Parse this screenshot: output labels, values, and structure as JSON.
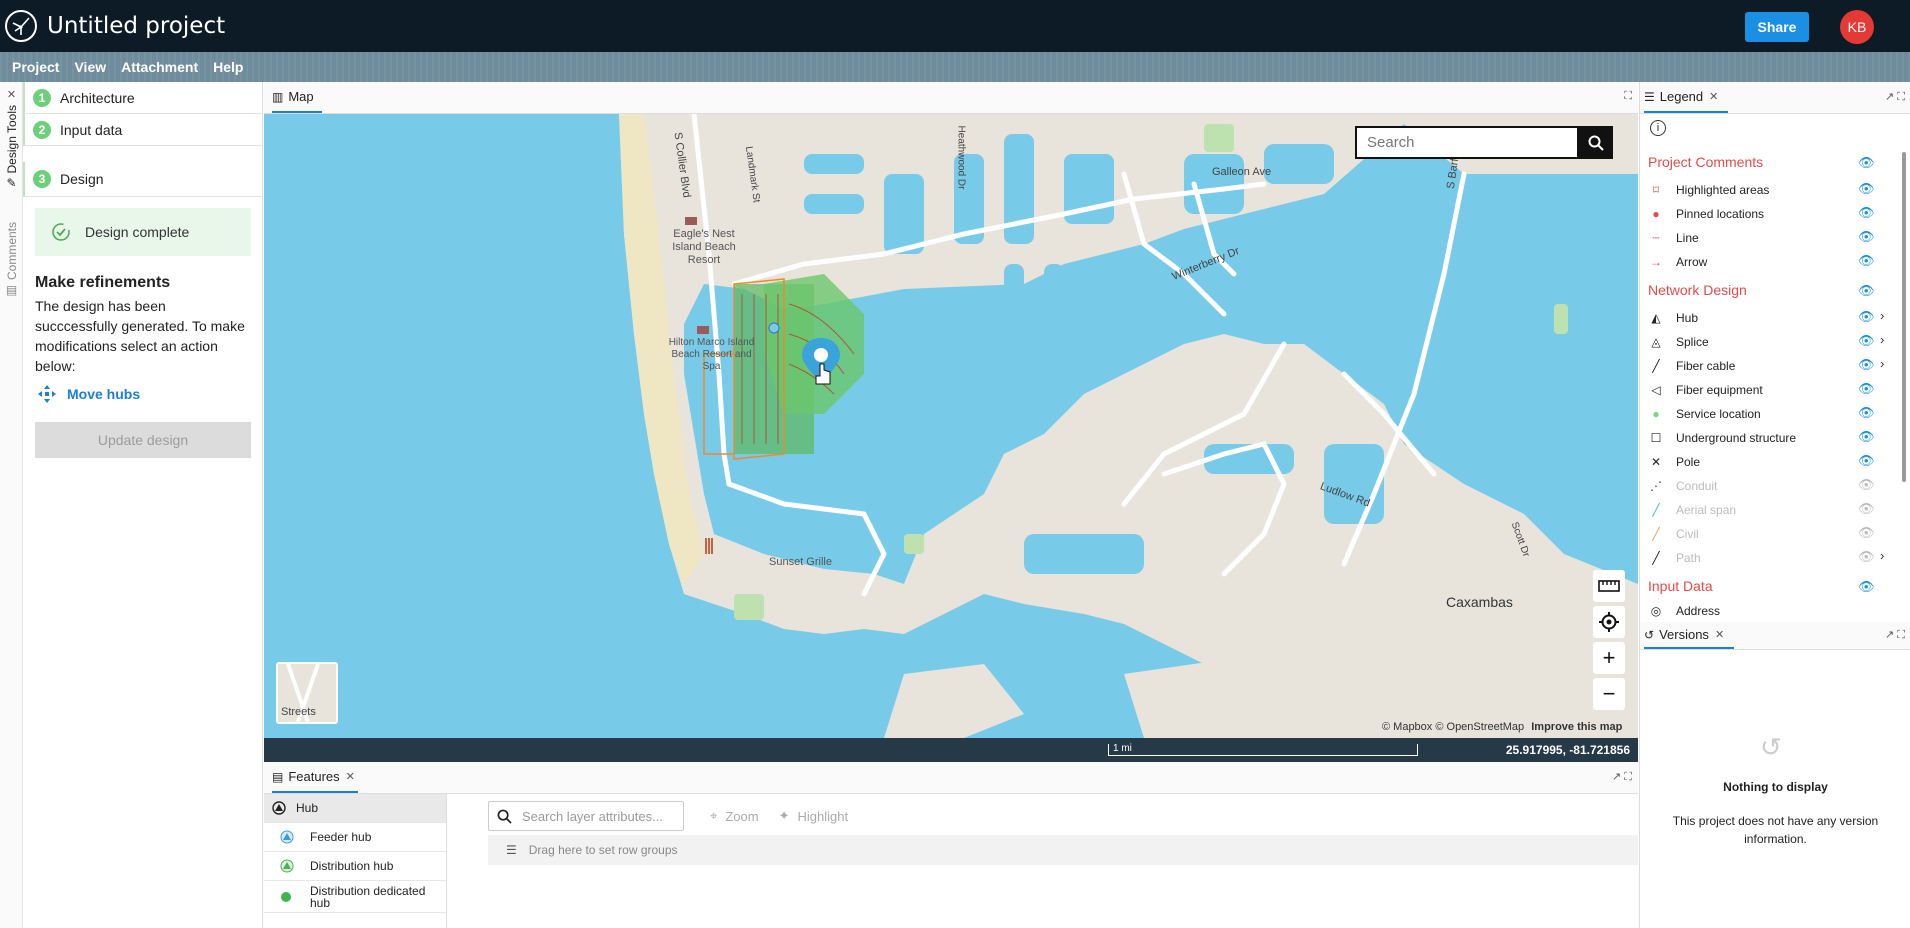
{
  "app": {
    "title": "Untitled project",
    "share_label": "Share",
    "avatar_initials": "KB"
  },
  "menu": [
    "Project",
    "View",
    "Attachment",
    "Help"
  ],
  "vertical_tabs": {
    "design_tools": "Design Tools",
    "comments": "Comments"
  },
  "design_panel": {
    "steps": [
      {
        "num": "1",
        "label": "Architecture"
      },
      {
        "num": "2",
        "label": "Input data"
      },
      {
        "num": "3",
        "label": "Design"
      }
    ],
    "status": "Design complete",
    "refine_title": "Make refinements",
    "refine_desc": "The design has been succcessfully generated. To make modifications select an action below:",
    "move_hubs": "Move hubs",
    "update_button": "Update design"
  },
  "map": {
    "tab_label": "Map",
    "search_placeholder": "Search",
    "labels": {
      "collier": "S Collier Blvd",
      "landmark": "Landmark St",
      "heathwood": "Heathwood Dr",
      "galleon": "Galleon Ave",
      "barfield": "S Barfield Dr",
      "winterberry": "Winterberry Dr",
      "eagles": "Eagle's Nest Island Beach Resort",
      "hilton": "Hilton Marco Island Beach Resort and Spa",
      "sunset": "Sunset Grille",
      "ludlow": "Ludlow Rd",
      "scott": "Scott Dr",
      "caxambas": "Caxambas"
    },
    "basemap_label": "Streets",
    "attribution": "© Mapbox © OpenStreetMap",
    "improve": "Improve this map",
    "scale": "1 mi",
    "coords": "25.917995, -81.721856"
  },
  "features": {
    "tab_label": "Features",
    "items": [
      "Hub",
      "Feeder hub",
      "Distribution hub",
      "Distribution dedicated hub"
    ],
    "search_placeholder": "Search layer attributes...",
    "zoom": "Zoom",
    "highlight": "Highlight",
    "row_groups": "Drag here to set row groups"
  },
  "legend": {
    "tab_label": "Legend",
    "cat_project_comments": "Project Comments",
    "project_comments": [
      "Highlighted areas",
      "Pinned locations",
      "Line",
      "Arrow"
    ],
    "cat_network_design": "Network Design",
    "network_design": [
      "Hub",
      "Splice",
      "Fiber cable",
      "Fiber equipment",
      "Service location",
      "Underground structure",
      "Pole",
      "Conduit",
      "Aerial span",
      "Civil",
      "Path"
    ],
    "cat_input_data": "Input Data",
    "input_data": [
      "Address"
    ]
  },
  "versions": {
    "tab_label": "Versions",
    "empty_title": "Nothing to display",
    "empty_desc": "This project does not have any version information."
  },
  "colors": {
    "accent": "#1a8fe3",
    "water": "#78cbe8",
    "land": "#e8e4dc",
    "legend_category": "#e04b4b"
  }
}
